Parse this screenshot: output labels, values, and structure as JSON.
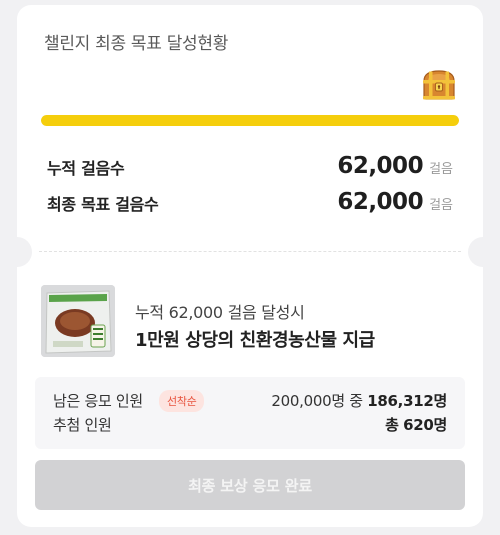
{
  "challenge": {
    "title": "챌린지 최종 목표 달성현황",
    "progress_fraction": 1.0,
    "progress_color": "#F5CE0C",
    "reward_icon": "treasure-chest-icon"
  },
  "stats": [
    {
      "label": "누적 걸음수",
      "value": "62,000",
      "unit": "걸음"
    },
    {
      "label": "최종 목표 걸음수",
      "value": "62,000",
      "unit": "걸음"
    }
  ],
  "reward": {
    "image": "product-bag-image",
    "subtitle": "누적 62,000 걸음 달성시",
    "title": "1만원 상당의 친환경농산물 지급"
  },
  "entries": {
    "remaining_label": "남은 응모 인원",
    "badge": "선착순",
    "remaining_total": "200,000명 중",
    "remaining_count": "186,312명",
    "winners_label": "추첨 인원",
    "winners_prefix": "총",
    "winners_count": "620명"
  },
  "button": {
    "label": "최종 보상 응모 완료"
  },
  "colors": {
    "background": "#F1F1F3",
    "card": "#FFFFFF",
    "badge_text": "#E8543F",
    "badge_bg": "#FDE4E0",
    "button_disabled": "#D2D2D4"
  }
}
